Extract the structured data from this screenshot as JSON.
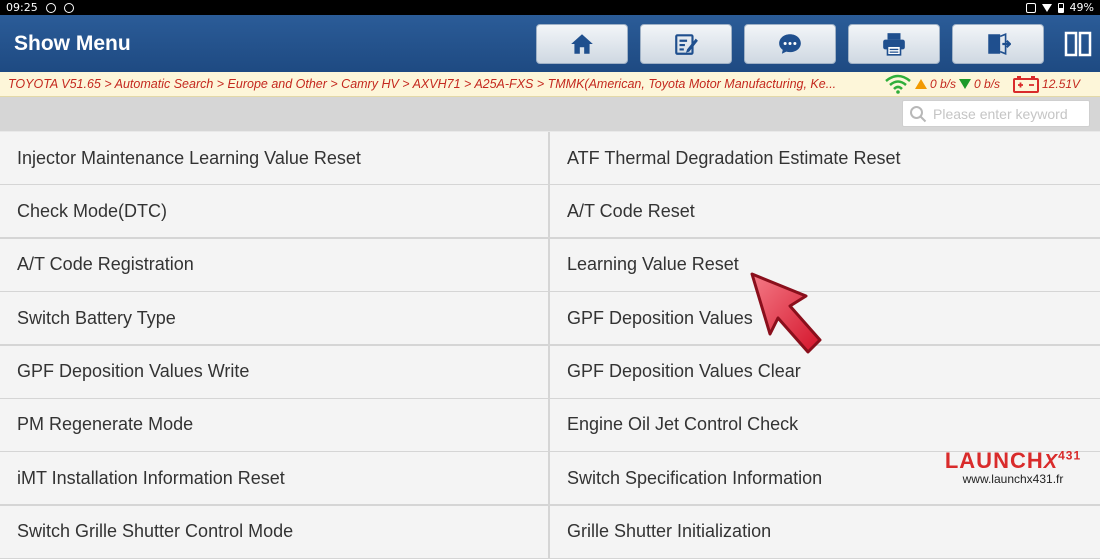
{
  "status": {
    "time": "09:25",
    "battery": "49%"
  },
  "header": {
    "title": "Show Menu",
    "icons": [
      "home-icon",
      "edit-report-icon",
      "chat-icon",
      "print-icon",
      "exit-icon",
      "split-view-icon"
    ]
  },
  "breadcrumb": {
    "path": "TOYOTA V51.65 > Automatic Search > Europe and Other > Camry HV > AXVH71 > A25A-FXS > TMMK(American, Toyota Motor Manufacturing, Ke...",
    "upload": "0 b/s",
    "download": "0 b/s",
    "voltage": "12.51V"
  },
  "search": {
    "placeholder": "Please enter keyword"
  },
  "menu": {
    "items": [
      "Injector Maintenance Learning Value Reset",
      "ATF Thermal Degradation Estimate Reset",
      "Check Mode(DTC)",
      "A/T Code Reset",
      "A/T Code Registration",
      "Learning Value Reset",
      "Switch Battery Type",
      "GPF Deposition Values",
      "GPF Deposition Values Write",
      "GPF Deposition Values Clear",
      "PM Regenerate Mode",
      "Engine Oil Jet Control Check",
      "iMT Installation Information Reset",
      "Switch Specification Information",
      "Switch Grille Shutter Control Mode",
      "Grille Shutter Initialization"
    ]
  },
  "watermark": {
    "brand": "LAUNCH",
    "x": "X",
    "model": "431",
    "url": "www.launchx431.fr"
  },
  "colors": {
    "header": "#2b5c98",
    "crumb_text": "#c4281e",
    "crumb_bg": "#fdf6d9",
    "pointer": "#e3263a"
  }
}
